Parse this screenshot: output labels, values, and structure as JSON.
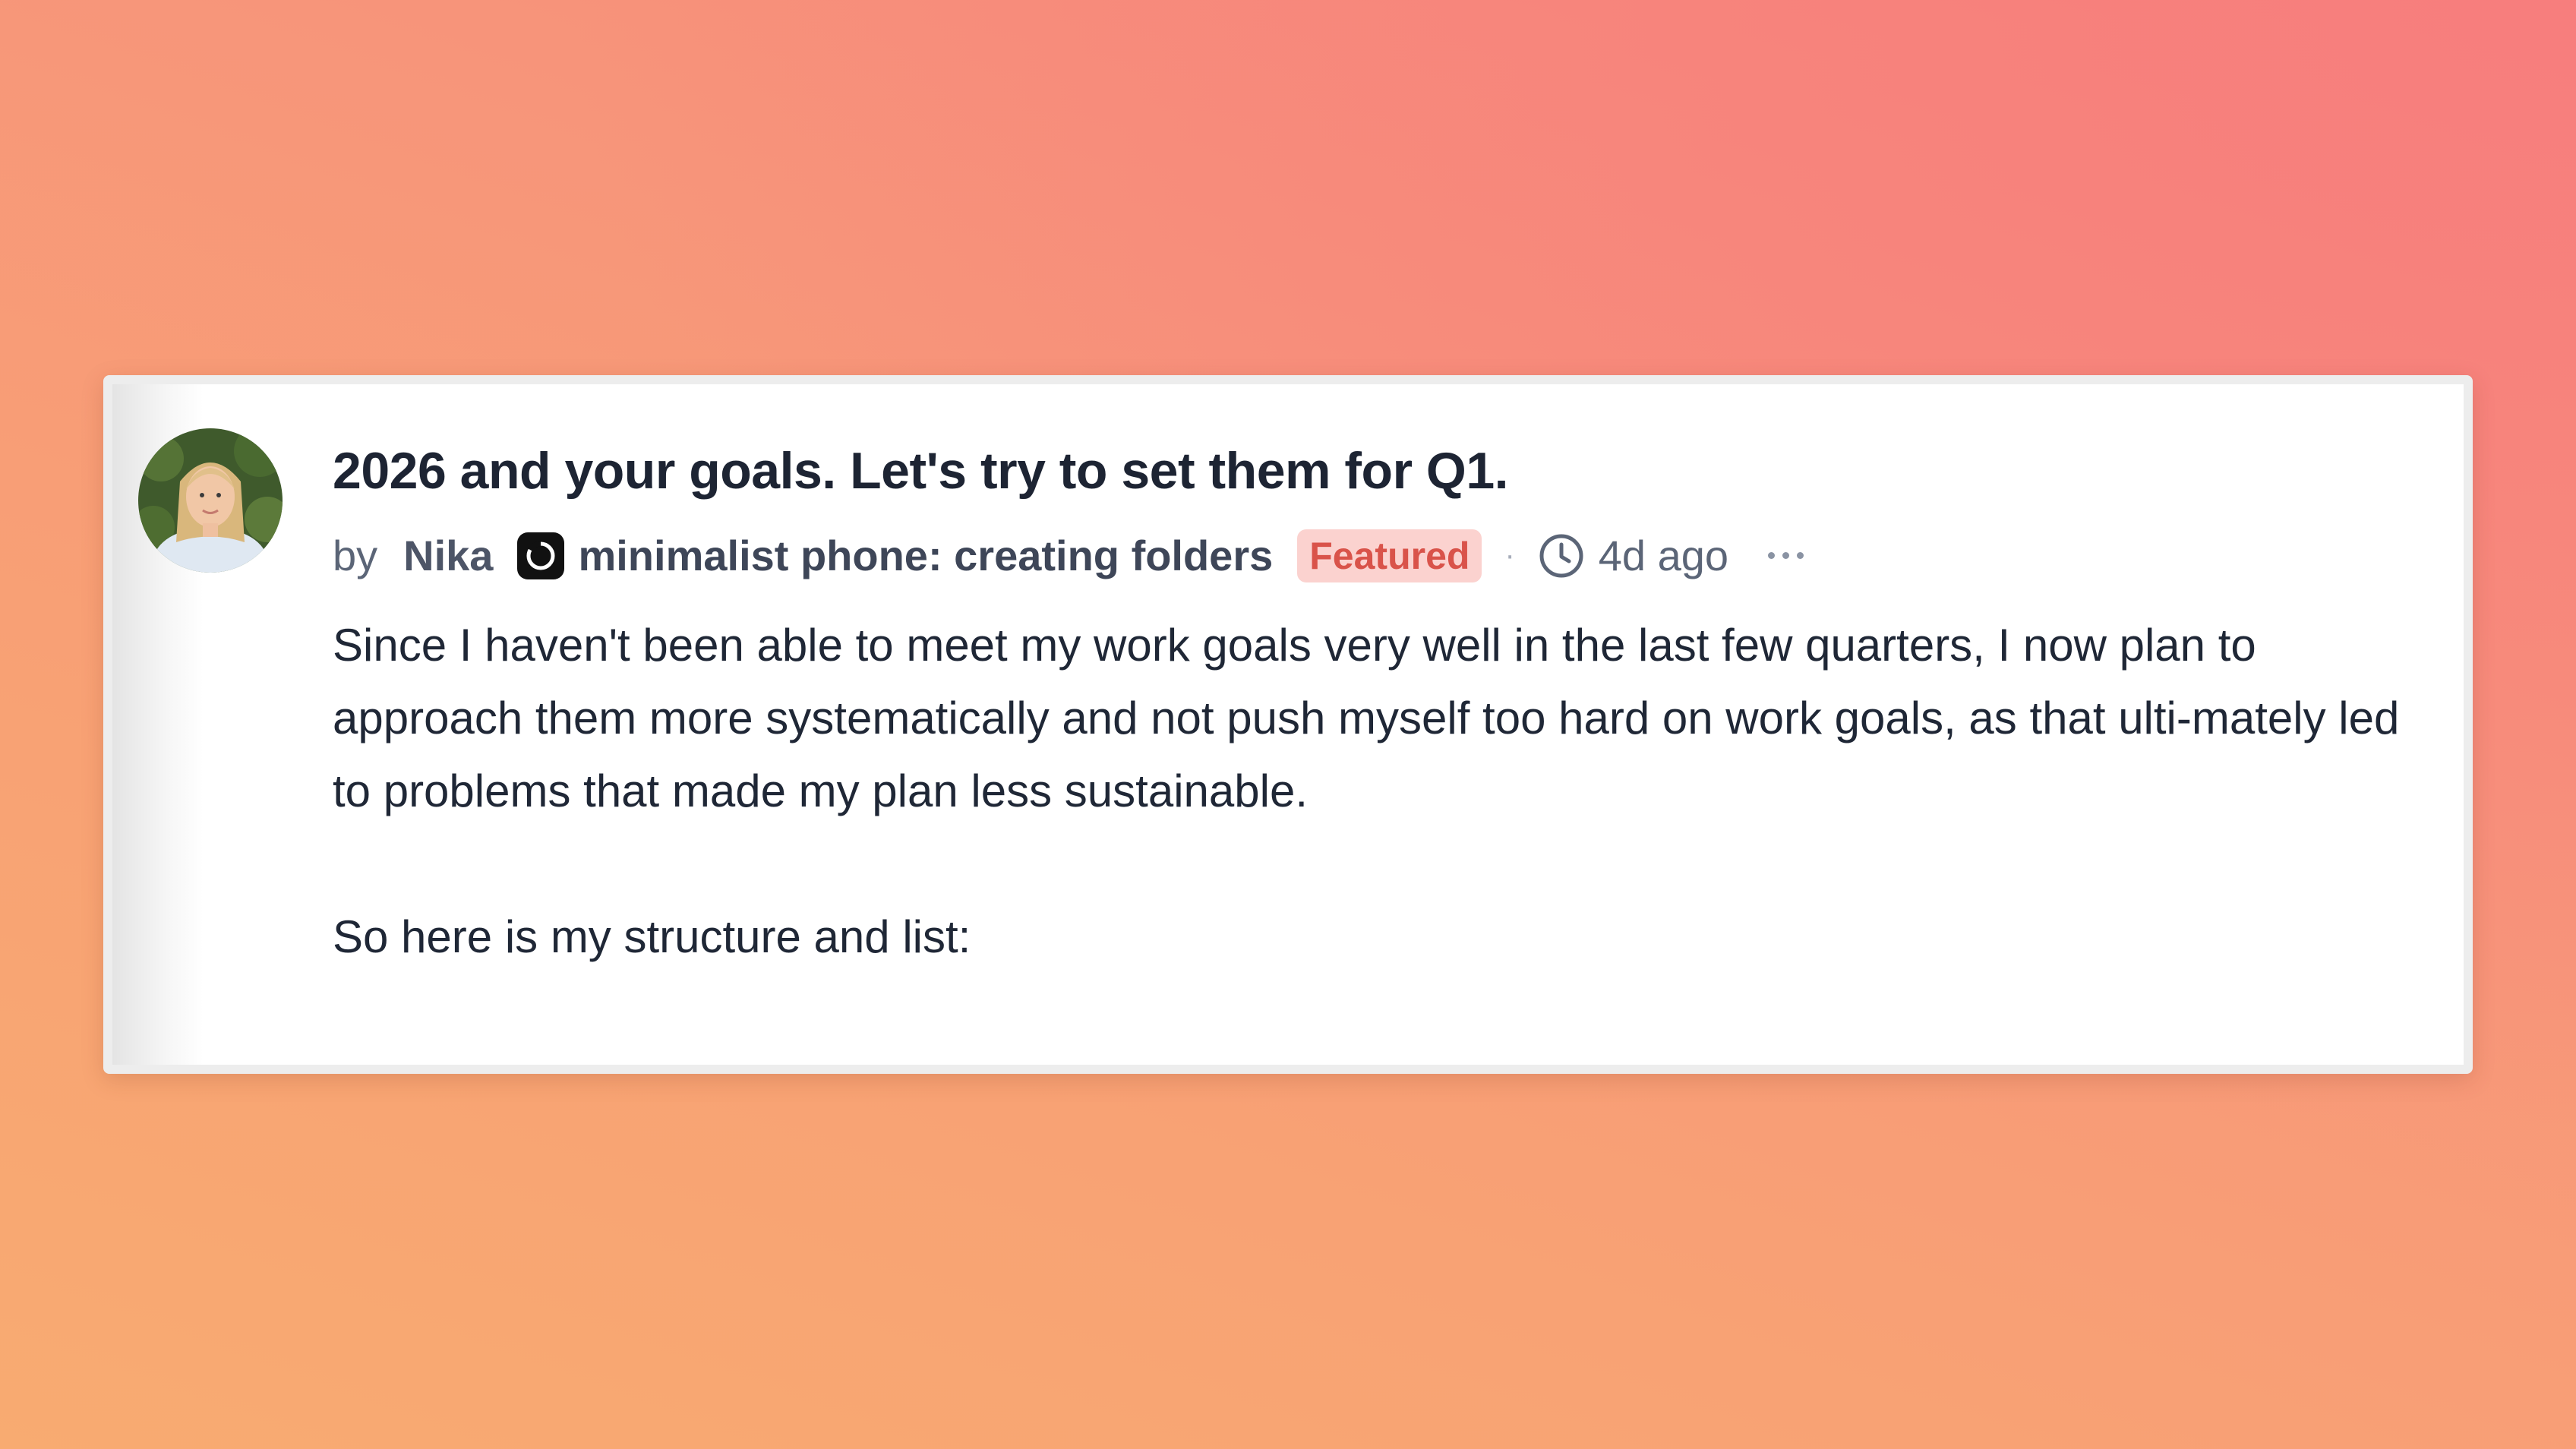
{
  "post": {
    "title": "2026 and your goals. Let's try to set them for Q1.",
    "by_label": "by",
    "author": "Nika",
    "publication": "minimalist phone: creating folders",
    "badge": "Featured",
    "separator": "·",
    "time_ago": "4d ago",
    "paragraphs": [
      "Since I haven't been able to meet my work goals very well in the last few quarters, I now plan to approach them more systematically and not push myself too hard on work goals, as that ulti-mately led to problems that made my plan less sustainable.",
      "So here is my structure and list:"
    ]
  },
  "icons": {
    "publication": "minimalist-phone-logo-icon",
    "time": "clock-icon",
    "menu": "more-horizontal-icon"
  },
  "colors": {
    "badge_bg": "#fbd2cf",
    "badge_text": "#d9534a",
    "title": "#1d2433"
  }
}
